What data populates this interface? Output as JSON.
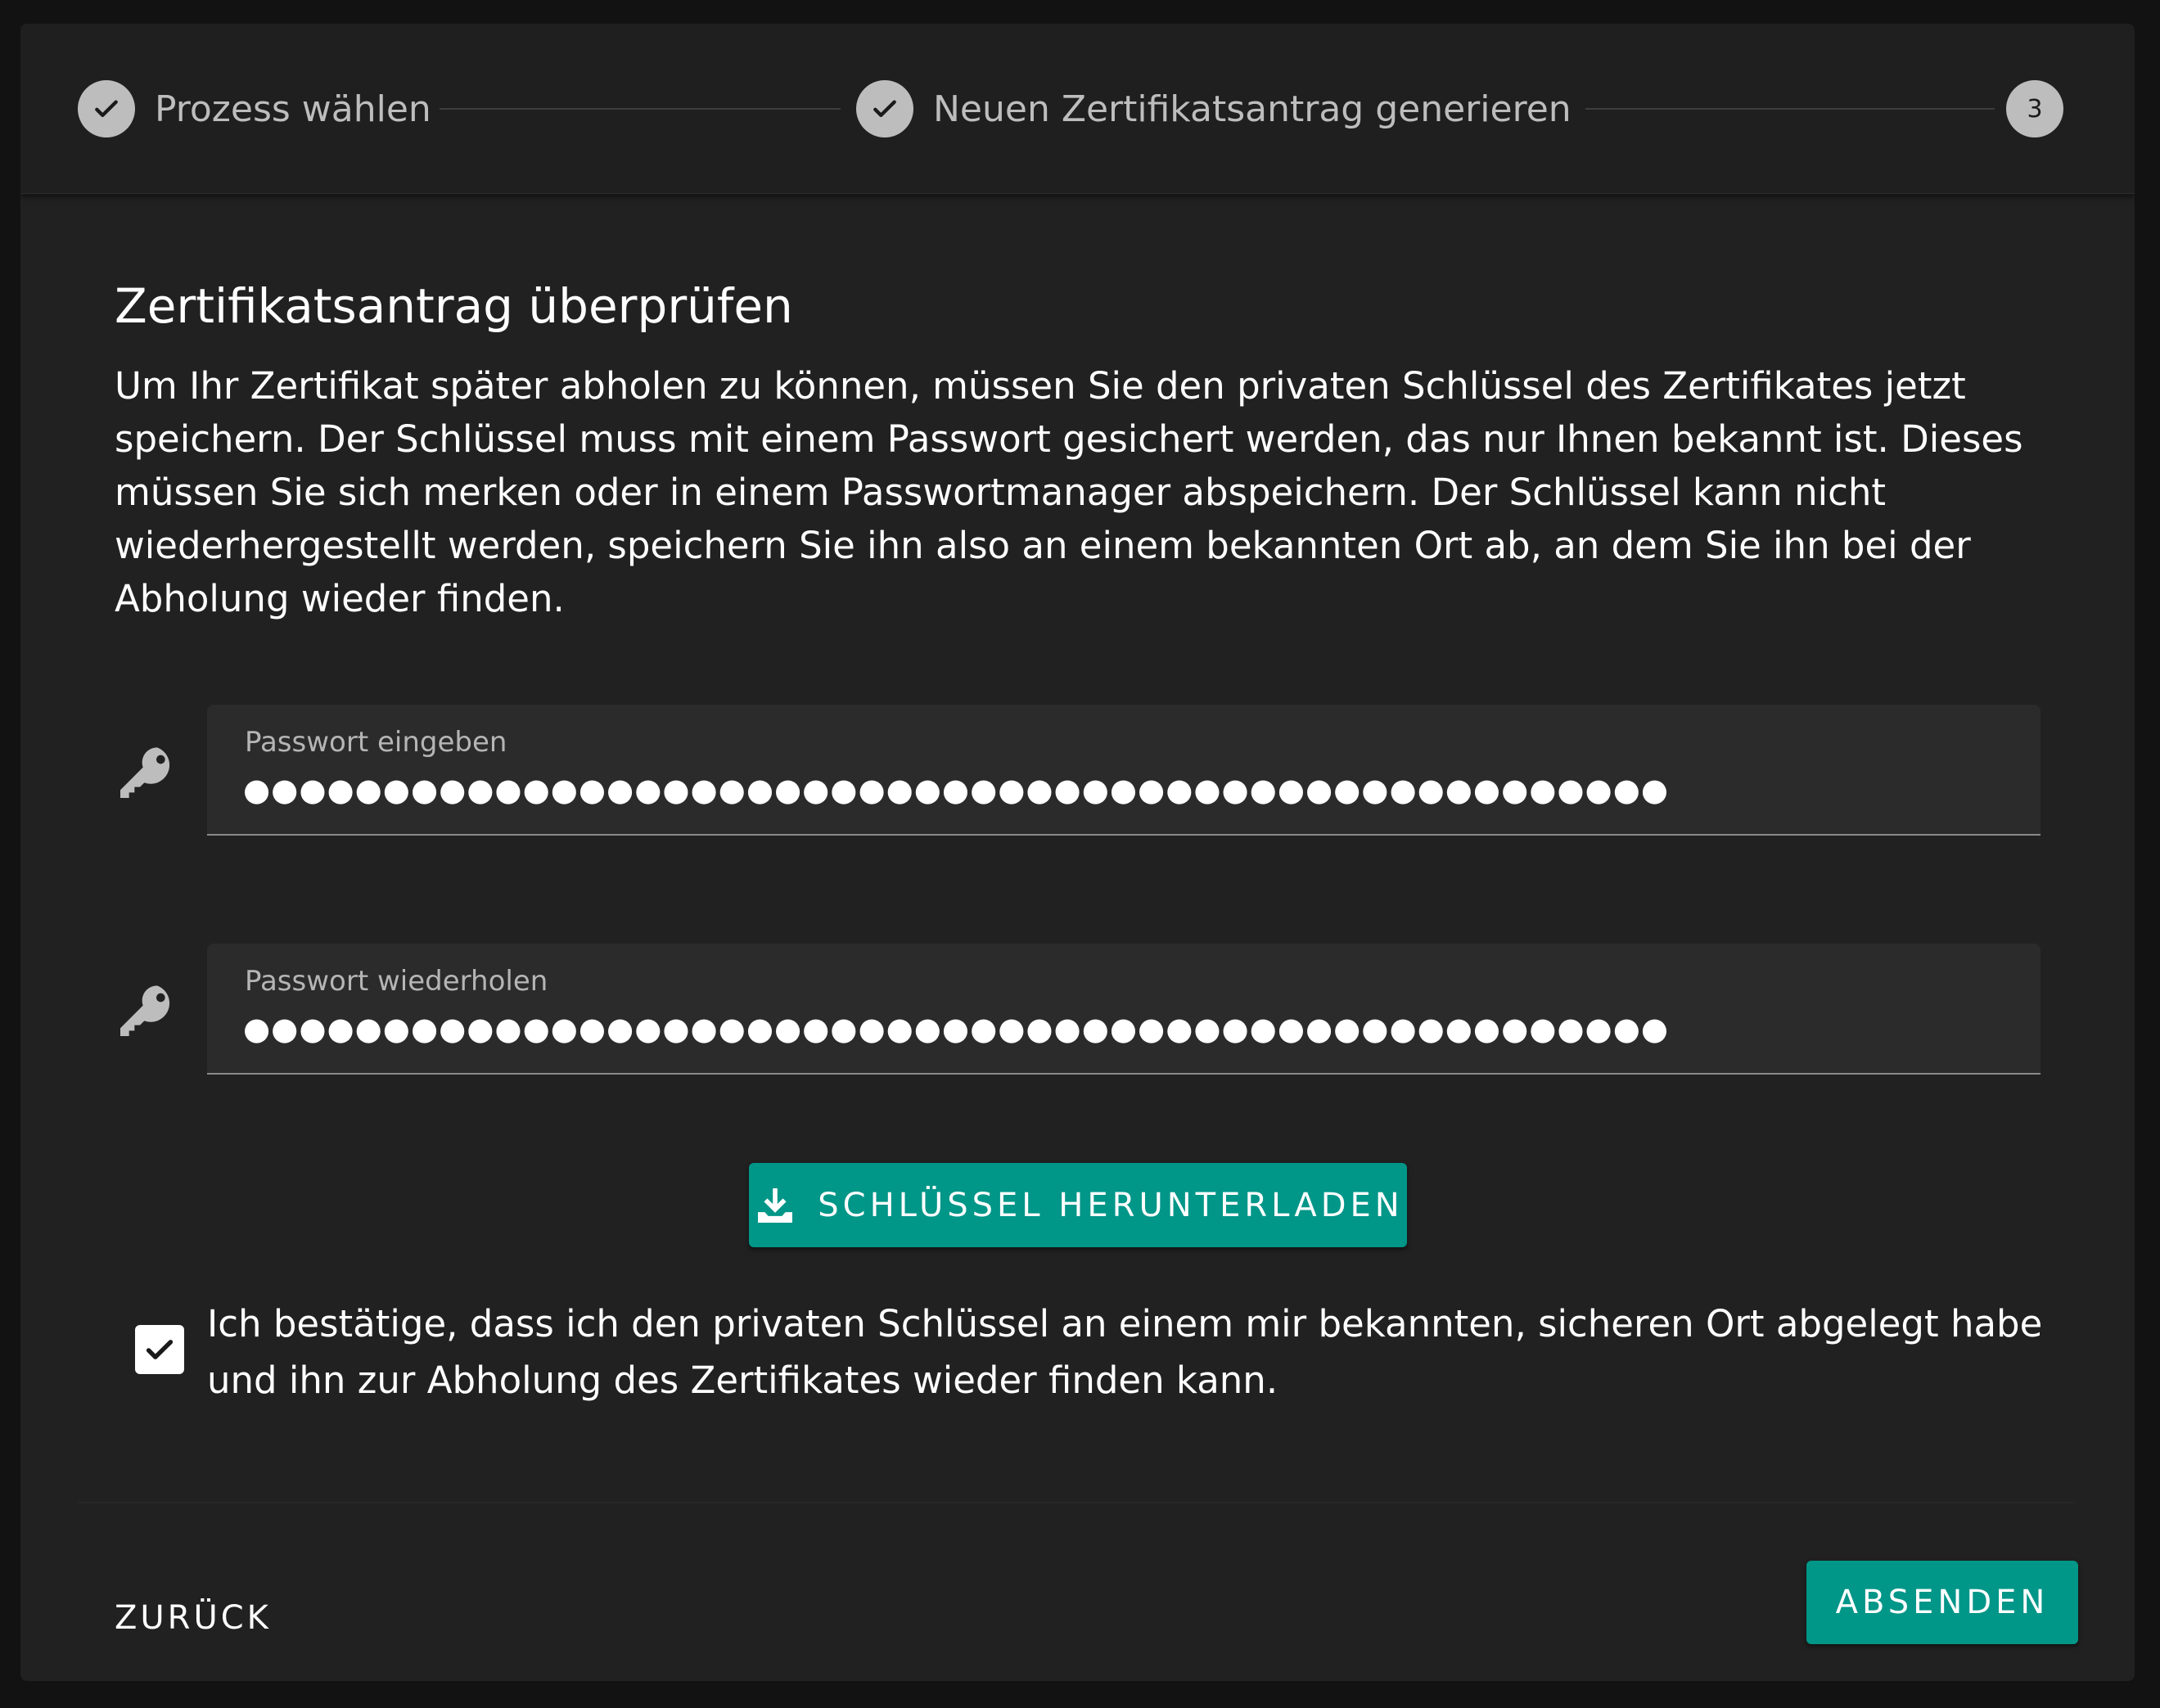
{
  "stepper": {
    "steps": [
      {
        "label": "Prozess wählen",
        "state": "done",
        "icon": "check-icon"
      },
      {
        "label": "Neuen Zertifikatsantrag generieren",
        "state": "done",
        "icon": "check-icon"
      },
      {
        "label": "",
        "number": "3",
        "state": "active"
      }
    ]
  },
  "content": {
    "title": "Zertifikatsantrag überprüfen",
    "description": "Um Ihr Zertifikat später abholen zu können, müssen Sie den privaten Schlüssel des Zertifikates jetzt speichern. Der Schlüssel muss mit einem Passwort gesichert werden, das nur Ihnen bekannt ist. Dieses müssen Sie sich merken oder in einem Passwortmanager abspeichern. Der Schlüssel kann nicht wiederhergestellt werden, speichern Sie ihn also an einem bekannten Ort ab, an dem Sie ihn bei der Abholung wieder finden."
  },
  "password_fields": [
    {
      "label": "Passwort eingeben",
      "value": "●●●●●●●●●●●●●●●●●●●●●●●●●●●●●●●●●●●●●●●●●●●●●●●●●●●",
      "icon": "key-icon"
    },
    {
      "label": "Passwort wiederholen",
      "value": "●●●●●●●●●●●●●●●●●●●●●●●●●●●●●●●●●●●●●●●●●●●●●●●●●●●",
      "icon": "key-icon"
    }
  ],
  "download_button": {
    "label": "SCHLÜSSEL HERUNTERLADEN",
    "icon": "download-icon"
  },
  "confirmation": {
    "checked": true,
    "text": "Ich bestätige, dass ich den privaten Schlüssel an einem mir bekannten, sicheren Ort abgelegt habe und ihn zur Abholung des Zertifikates wieder finden kann."
  },
  "footer": {
    "back_label": "ZURÜCK",
    "submit_label": "ABSENDEN"
  },
  "colors": {
    "accent": "#009688",
    "background": "#212121",
    "step_circle": "#bdbdbd"
  }
}
